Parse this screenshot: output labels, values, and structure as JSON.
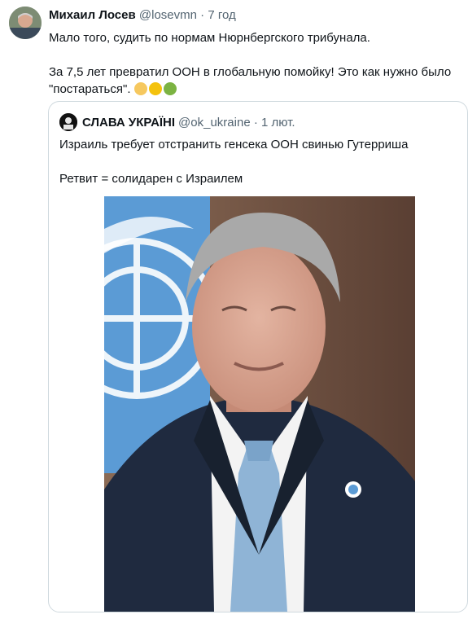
{
  "tweet": {
    "author_name": "Михаил Лосев",
    "author_handle": "@losevmn",
    "separator": "·",
    "time": "7 год",
    "line1": "Мало того, судить по нормам Нюрнбергского трибунала.",
    "line2": "За 7,5 лет превратил ООН в глобальную помойку! Это как нужно было",
    "line3": "\"постараться\".",
    "emojis": [
      "woman-facepalming-emoji",
      "grinning-squinting-emoji",
      "nauseated-face-emoji"
    ]
  },
  "quote": {
    "author_name": "СЛАВА УКРАЇНІ",
    "author_handle": "@ok_ukraine",
    "separator": "·",
    "time": "1 лют.",
    "line1": "Израиль требует отстранить генсека ООН свинью Гутерриша",
    "line2": "Ретвит = солидарен с Израилем"
  },
  "colors": {
    "text": "#0f1419",
    "muted": "#536471",
    "border": "#cfd9de",
    "un_blue": "#5b9bd5"
  }
}
